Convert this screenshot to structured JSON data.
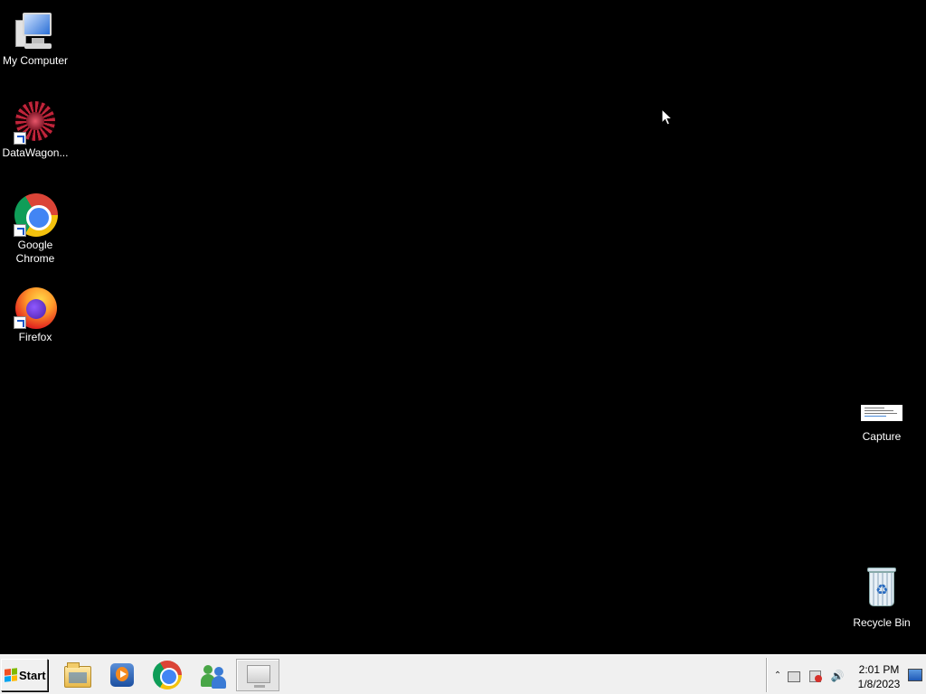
{
  "desktop": {
    "icons": [
      {
        "label": "My Computer"
      },
      {
        "label": "DataWagon..."
      },
      {
        "label": "Google\nChrome"
      },
      {
        "label": "Firefox"
      },
      {
        "label": "Capture"
      },
      {
        "label": "Recycle Bin"
      }
    ]
  },
  "taskbar": {
    "start_label": "Start",
    "start_logo_colors": [
      "#f25022",
      "#7fba00",
      "#00a4ef",
      "#ffb900"
    ],
    "pinned": [
      {
        "icon": "file-explorer-icon"
      },
      {
        "icon": "media-player-icon"
      },
      {
        "icon": "chrome-icon"
      },
      {
        "icon": "people-icon"
      },
      {
        "icon": "computer-window-icon",
        "active": true
      }
    ],
    "tray": {
      "time": "2:01 PM",
      "date": "1/8/2023"
    }
  }
}
